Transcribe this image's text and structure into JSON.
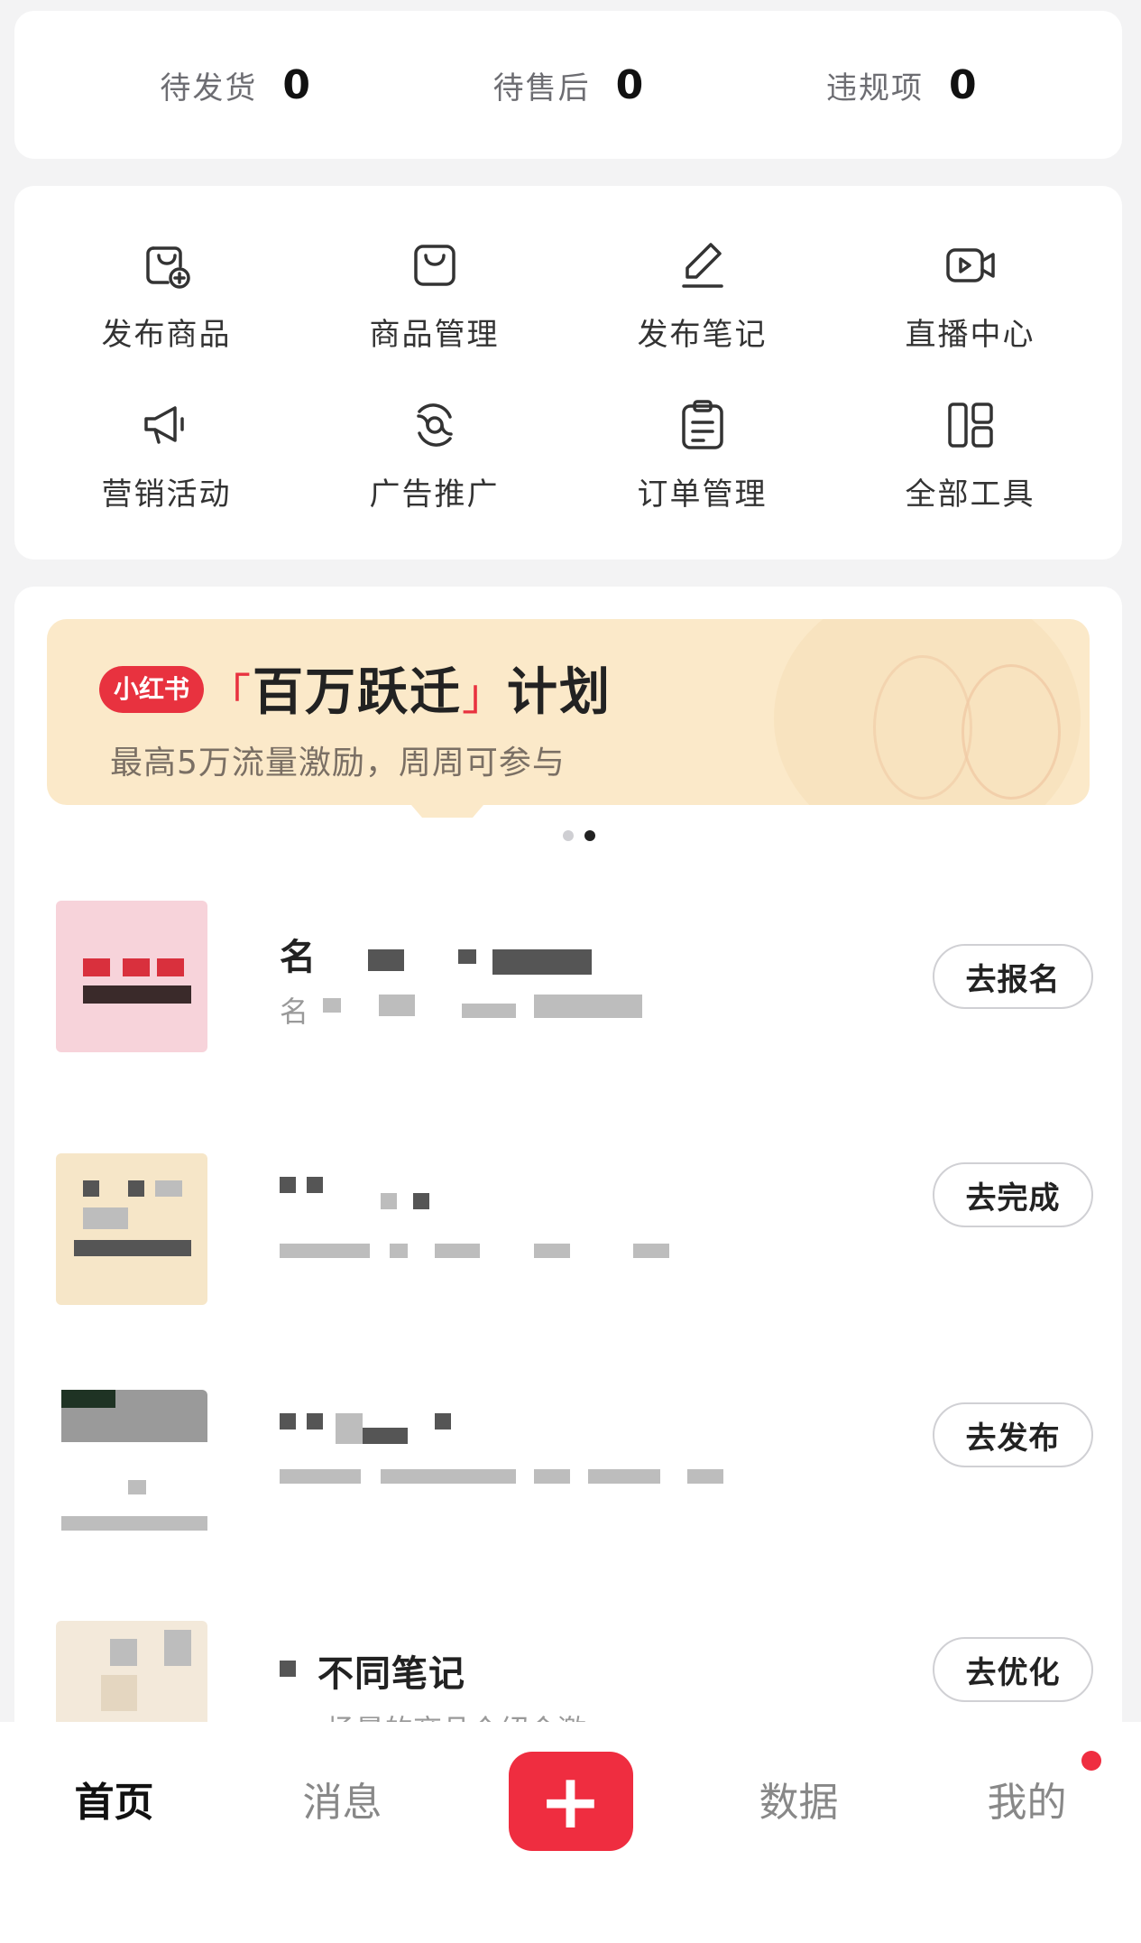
{
  "stats": [
    {
      "label": "待发货",
      "value": "0"
    },
    {
      "label": "待售后",
      "value": "0"
    },
    {
      "label": "违规项",
      "value": "0"
    }
  ],
  "tools": [
    {
      "label": "发布商品",
      "icon": "publish-product-icon"
    },
    {
      "label": "商品管理",
      "icon": "shopping-bag-icon"
    },
    {
      "label": "发布笔记",
      "icon": "pen-icon"
    },
    {
      "label": "直播中心",
      "icon": "live-camera-icon"
    },
    {
      "label": "营销活动",
      "icon": "megaphone-icon"
    },
    {
      "label": "广告推广",
      "icon": "swirl-icon"
    },
    {
      "label": "订单管理",
      "icon": "clipboard-icon"
    },
    {
      "label": "全部工具",
      "icon": "grid-icon"
    }
  ],
  "banner": {
    "brand": "小红书",
    "title": "百万跃迁",
    "title_suffix": "计划",
    "subtitle": "最高5万流量激励，周周可参与",
    "colors": {
      "background": "#fbe9c9",
      "brand": "#e8323f"
    }
  },
  "carousel": {
    "count": 2,
    "active": 1
  },
  "tasks": [
    {
      "title": "名",
      "desc": "名",
      "button": "去报名"
    },
    {
      "title": "",
      "desc": "",
      "button": "去完成"
    },
    {
      "title": "",
      "desc": "",
      "button": "去发布"
    },
    {
      "title": "不同笔记",
      "desc": "场景的商品介绍会激",
      "button": "去优化"
    }
  ],
  "tabbar": {
    "tabs": [
      {
        "label": "首页",
        "active": true
      },
      {
        "label": "消息",
        "active": false
      },
      {
        "label": "+",
        "active": false
      },
      {
        "label": "数据",
        "active": false
      },
      {
        "label": "我的",
        "active": false,
        "badge": true
      }
    ],
    "accent": "#ef2d40"
  }
}
